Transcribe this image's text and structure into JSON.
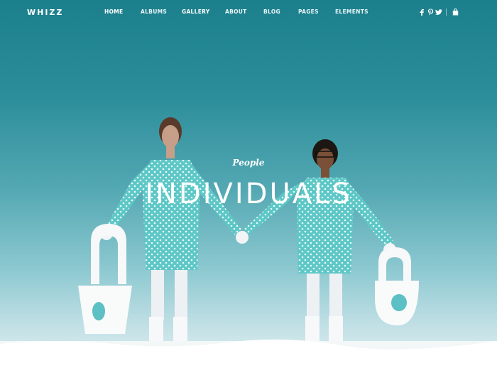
{
  "header": {
    "logo": "WHIZZ",
    "nav": [
      {
        "label": "HOME",
        "active": true
      },
      {
        "label": "ALBUMS",
        "active": false
      },
      {
        "label": "GALLERY",
        "active": true
      },
      {
        "label": "ABOUT",
        "active": false
      },
      {
        "label": "BLOG",
        "active": false
      },
      {
        "label": "PAGES",
        "active": false
      },
      {
        "label": "ELEMENTS",
        "active": false
      }
    ],
    "social_icons": [
      "facebook-icon",
      "pinterest-icon",
      "twitter-icon"
    ],
    "cart_icon": "shopping-bag-icon"
  },
  "hero": {
    "eyebrow": "People",
    "title": "INDIVIDUALS"
  },
  "colors": {
    "sky_top": "#1c7f8c",
    "sky_bottom": "#e6f1f3",
    "dress": "#5fc6c6",
    "text": "#ffffff"
  }
}
